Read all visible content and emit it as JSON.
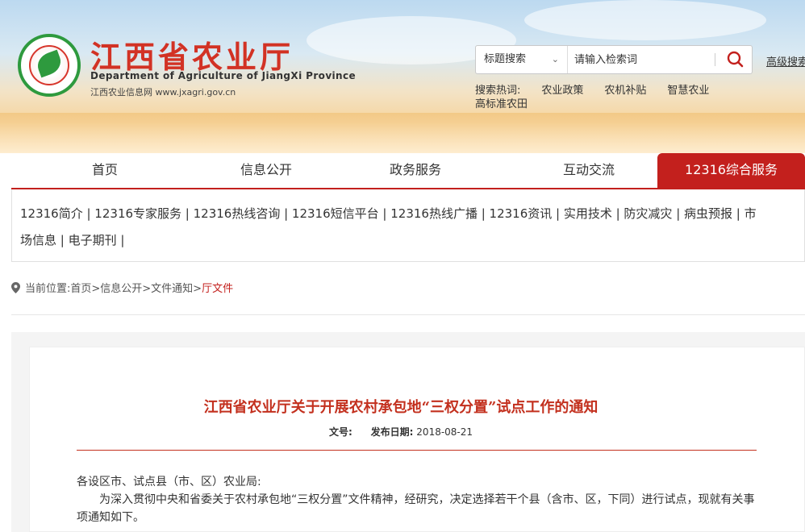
{
  "brand": {
    "title": "江西省农业厅",
    "english": "Department of Agriculture of JiangXi Province",
    "site": "江西农业信息网 www.jxagri.gov.cn",
    "logo_text": "Jiangxi Agriculture"
  },
  "search": {
    "type_label": "标题搜索",
    "placeholder": "请输入检索词",
    "advanced_label": "高级搜索"
  },
  "hot": {
    "label": "搜索热词:",
    "terms": [
      "农业政策",
      "农机补贴",
      "智慧农业",
      "高标准农田"
    ]
  },
  "nav": {
    "items": [
      "首页",
      "信息公开",
      "政务服务",
      "互动交流",
      "12316综合服务"
    ],
    "active": "12316综合服务"
  },
  "subnav": {
    "row1": "12316简介 | 12316专家服务 | 12316热线咨询 | 12316短信平台 | 12316热线广播 | 12316资讯 | 实用技术 | 防灾减灾 | 病虫预报 | 市",
    "row2": "场信息 | 电子期刊 |"
  },
  "breadcrumb": {
    "label": "当前位置:",
    "path": "首页>信息公开>文件通知>",
    "current": "厅文件"
  },
  "document": {
    "title": "江西省农业厅关于开展农村承包地“三权分置”试点工作的通知",
    "doc_no_label": "文号:",
    "date_label": "发布日期:",
    "date": "2018-08-21",
    "salutation": "各设区市、试点县（市、区）农业局:",
    "paragraph": "为深入贯彻中央和省委关于农村承包地“三权分置”文件精神，经研究，决定选择若干个县（含市、区，下同）进行试点，现就有关事项通知如下。"
  },
  "colors": {
    "brand_red": "#d23224",
    "nav_active": "#c3201d",
    "logo_green": "#2e9a3e"
  }
}
